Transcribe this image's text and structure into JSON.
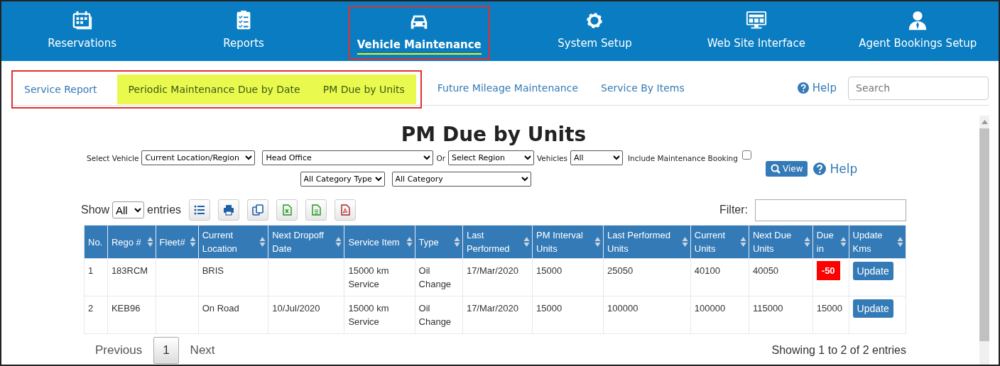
{
  "nav": [
    {
      "label": "Reservations",
      "selected": false,
      "annotated": false
    },
    {
      "label": "Reports",
      "selected": false,
      "annotated": false
    },
    {
      "label": "Vehicle Maintenance",
      "selected": true,
      "annotated": true
    },
    {
      "label": "System Setup",
      "selected": false,
      "annotated": false
    },
    {
      "label": "Web Site Interface",
      "selected": false,
      "annotated": false
    },
    {
      "label": "Agent Bookings Setup",
      "selected": false,
      "annotated": false
    }
  ],
  "subnav": {
    "tabs": [
      {
        "label": "Service Report",
        "highlighted": false,
        "boxed": true
      },
      {
        "label": "Periodic Maintenance Due by Date",
        "highlighted": true,
        "boxed": true
      },
      {
        "label": "PM Due by Units",
        "highlighted": true,
        "boxed": true
      },
      {
        "label": "Future Mileage Maintenance",
        "highlighted": false,
        "boxed": false
      },
      {
        "label": "Service By Items",
        "highlighted": false,
        "boxed": false
      }
    ],
    "help": "Help",
    "search_placeholder": "Search"
  },
  "title": "PM Due by Units",
  "filters": {
    "select_vehicle_label": "Select Vehicle",
    "vehicle_mode": "Current Location/Region",
    "location": "Head Office",
    "or_label": "Or",
    "region": "Select Region",
    "vehicles_label": "Vehicles",
    "vehicles": "All",
    "include_label": "Include Maintenance Booking",
    "include_checked": false,
    "category_type": "All Category Type",
    "category": "All Category",
    "view_button": "View",
    "help": "Help"
  },
  "toolbar": {
    "show_label": "Show",
    "page_size": "All",
    "entries_label": "entries",
    "filter_label": "Filter:"
  },
  "table": {
    "columns": [
      "No.",
      "Rego #",
      "Fleet#",
      "Current Location",
      "Next Dropoff Date",
      "Service Item",
      "Type",
      "Last Performed",
      "PM Interval Units",
      "Last Performed Units",
      "Current Units",
      "Next Due Units",
      "Due in",
      "Update Kms"
    ],
    "rows": [
      {
        "cells": [
          "1",
          "183RCM",
          "",
          "BRIS",
          "",
          "15000 km Service",
          "Oil Change",
          "17/Mar/2020",
          "15000",
          "25050",
          "40100",
          "40050",
          "-50"
        ],
        "overdue": true,
        "action": "Update"
      },
      {
        "cells": [
          "2",
          "KEB96",
          "",
          "On Road",
          "10/Jul/2020",
          "15000 km Service",
          "Oil Change",
          "17/Mar/2020",
          "15000",
          "100000",
          "100000",
          "115000",
          "15000"
        ],
        "overdue": false,
        "action": "Update"
      }
    ]
  },
  "pagination": {
    "previous": "Previous",
    "pages": [
      {
        "label": "1",
        "selected": true
      }
    ],
    "next": "Next",
    "info": "Showing 1 to 2 of 2 entries"
  }
}
